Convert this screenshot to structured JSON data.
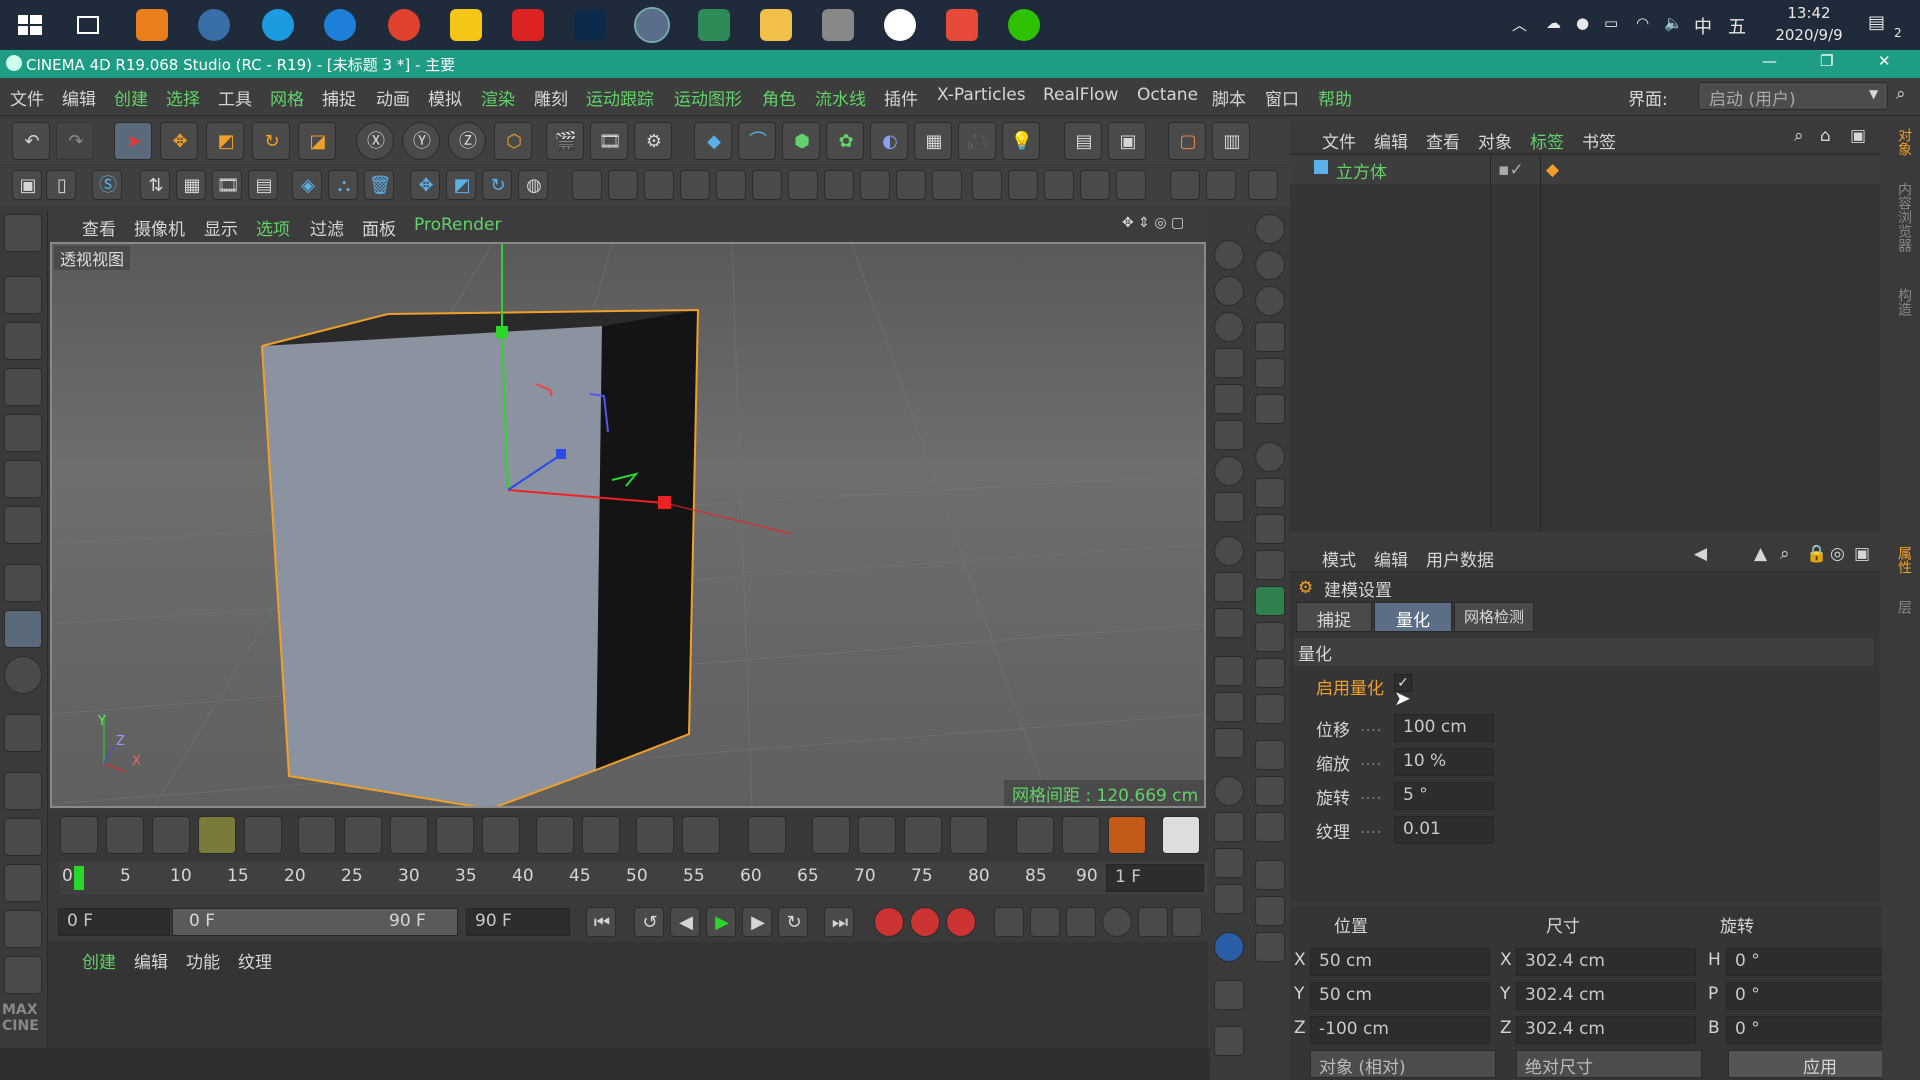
{
  "taskbar": {
    "time": "13:42",
    "date": "2020/9/9",
    "ime": "中",
    "ime2": "五",
    "notif_count": "2"
  },
  "titlebar": {
    "title": "CINEMA 4D R19.068 Studio (RC - R19) - [未标题 3 *] - 主要"
  },
  "menubar": {
    "items": [
      "文件",
      "编辑",
      "创建",
      "选择",
      "工具",
      "网格",
      "捕捉",
      "动画",
      "模拟",
      "渲染",
      "雕刻",
      "运动跟踪",
      "运动图形",
      "角色",
      "流水线",
      "插件",
      "X-Particles",
      "RealFlow",
      "Octane",
      "脚本",
      "窗口",
      "帮助"
    ],
    "layout_label": "界面:",
    "layout_value": "启动 (用户)"
  },
  "viewport_menu": {
    "items": [
      "查看",
      "摄像机",
      "显示",
      "选项",
      "过滤",
      "面板",
      "ProRender"
    ]
  },
  "viewport": {
    "label": "透视视图",
    "grid_spacing": "网格间距 : 120.669 cm",
    "axis_y": "Y",
    "axis_z": "Z",
    "axis_x": "X"
  },
  "timeline": {
    "ticks": [
      "0",
      "5",
      "10",
      "15",
      "20",
      "25",
      "30",
      "35",
      "40",
      "45",
      "50",
      "55",
      "60",
      "65",
      "70",
      "75",
      "80",
      "85",
      "90"
    ],
    "current_frame_field": "1 F"
  },
  "transport": {
    "start_field": "0 F",
    "range_start": "0 F",
    "range_end": "90 F",
    "end_field": "90 F"
  },
  "material_panel": {
    "tabs": [
      "创建",
      "编辑",
      "功能",
      "纹理"
    ]
  },
  "object_manager": {
    "tabs": [
      "文件",
      "编辑",
      "查看",
      "对象",
      "标签",
      "书签"
    ],
    "object_name": "立方体"
  },
  "attribute_manager": {
    "tabs": [
      "模式",
      "编辑",
      "用户数据"
    ],
    "section_title": "建模设置",
    "subtabs": [
      "捕捉",
      "量化",
      "网格检测"
    ],
    "group_title": "量化",
    "enable_label": "启用量化",
    "fields": [
      {
        "label": "位移",
        "value": "100 cm"
      },
      {
        "label": "缩放",
        "value": "10 %"
      },
      {
        "label": "旋转",
        "value": "5 °"
      },
      {
        "label": "纹理",
        "value": "0.01"
      }
    ]
  },
  "coordinates": {
    "col_position": "位置",
    "col_size": "尺寸",
    "col_rotation": "旋转",
    "rows": [
      {
        "axis": "X",
        "pos": "50 cm",
        "saxis": "X",
        "size": "302.4 cm",
        "raxis": "H",
        "rot": "0 °"
      },
      {
        "axis": "Y",
        "pos": "50 cm",
        "saxis": "Y",
        "size": "302.4 cm",
        "raxis": "P",
        "rot": "0 °"
      },
      {
        "axis": "Z",
        "pos": "-100 cm",
        "saxis": "Z",
        "size": "302.4 cm",
        "raxis": "B",
        "rot": "0 °"
      }
    ],
    "mode_select": "对象 (相对)",
    "size_select": "绝对尺寸",
    "apply_label": "应用"
  },
  "right_tabs": [
    "对象",
    "内容浏览器",
    "构造",
    "属性",
    "层"
  ],
  "colors": {
    "title_bg": "#1f9c84",
    "accent_green": "#62d36a",
    "accent_orange": "#f0a028",
    "cube_outline": "#f0a028"
  }
}
